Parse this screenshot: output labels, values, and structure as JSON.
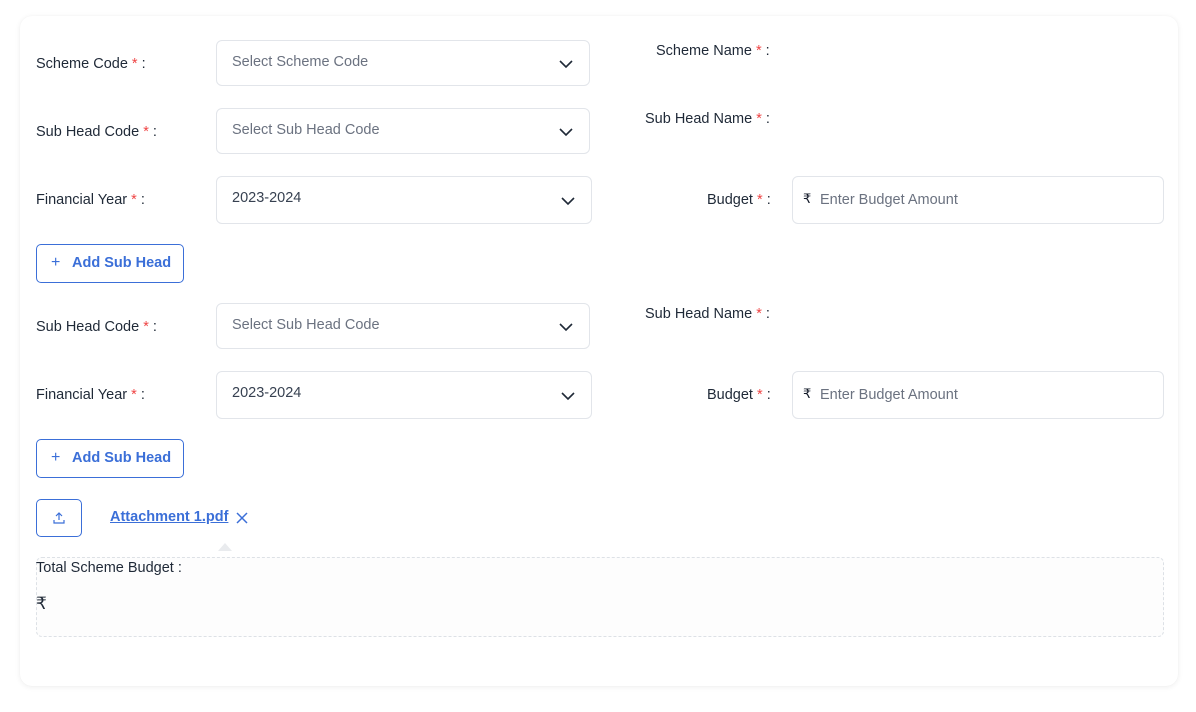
{
  "form": {
    "scheme_code": {
      "label": "Scheme Code",
      "placeholder": "Select Scheme Code"
    },
    "scheme_name": {
      "label": "Scheme Name"
    },
    "required_mark": "*",
    "colon": ":",
    "blocks": [
      {
        "sub_head_code": {
          "label": "Sub Head Code",
          "placeholder": "Select Sub Head Code"
        },
        "sub_head_name": {
          "label": "Sub Head Name"
        },
        "financial_year": {
          "label": "Financial Year",
          "value": "2023-2024"
        },
        "budget": {
          "label": "Budget",
          "currency": "₹",
          "placeholder": "Enter Budget Amount"
        },
        "add_button": {
          "icon": "+",
          "label": "Add Sub Head"
        }
      },
      {
        "sub_head_code": {
          "label": "Sub Head Code",
          "placeholder": "Select Sub Head Code"
        },
        "sub_head_name": {
          "label": "Sub Head Name"
        },
        "financial_year": {
          "label": "Financial Year",
          "value": "2023-2024"
        },
        "budget": {
          "label": "Budget",
          "currency": "₹",
          "placeholder": "Enter Budget Amount"
        },
        "add_button": {
          "icon": "+",
          "label": "Add Sub Head"
        }
      }
    ],
    "attachment": {
      "file_name": "Attachment 1.pdf"
    },
    "total": {
      "label": "Total Scheme Budget :",
      "currency": "₹"
    }
  },
  "colors": {
    "accent": "#3b6fd8",
    "required": "#ef4444",
    "border": "#e2e5ea"
  },
  "icons": [
    "chevron-down-icon",
    "upload-icon",
    "close-icon",
    "plus-icon"
  ]
}
